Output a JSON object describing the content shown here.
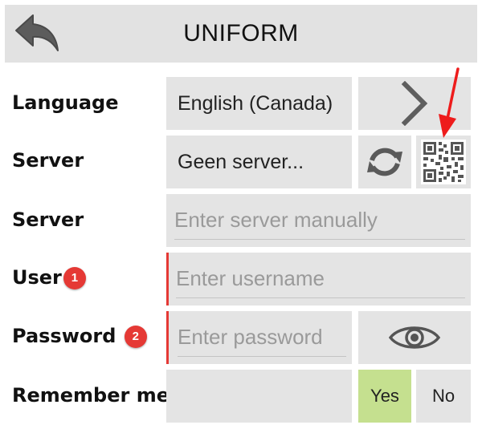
{
  "header": {
    "title": "UNIFORM",
    "back_icon": "back-arrow-icon"
  },
  "form": {
    "language": {
      "label": "Language",
      "value": "English (Canada)",
      "next_icon": "chevron-right-icon"
    },
    "server_select": {
      "label": "Server",
      "value": "Geen server...",
      "refresh_icon": "refresh-icon",
      "qr_icon": "qr-code-icon"
    },
    "server_manual": {
      "label": "Server",
      "placeholder": "Enter server manually"
    },
    "user": {
      "label": "User",
      "badge": "1",
      "placeholder": "Enter username"
    },
    "password": {
      "label": "Password",
      "badge": "2",
      "placeholder": "Enter password",
      "toggle_icon": "eye-icon"
    },
    "remember": {
      "label": "Remember me",
      "yes_label": "Yes",
      "no_label": "No",
      "selected": "Yes"
    }
  },
  "colors": {
    "cell_background": "#e4e4e4",
    "header_background": "#e2e2e2",
    "required_marker": "#e53935",
    "selected_option": "#c5e08f",
    "annotation_arrow": "#ee1c1c"
  }
}
